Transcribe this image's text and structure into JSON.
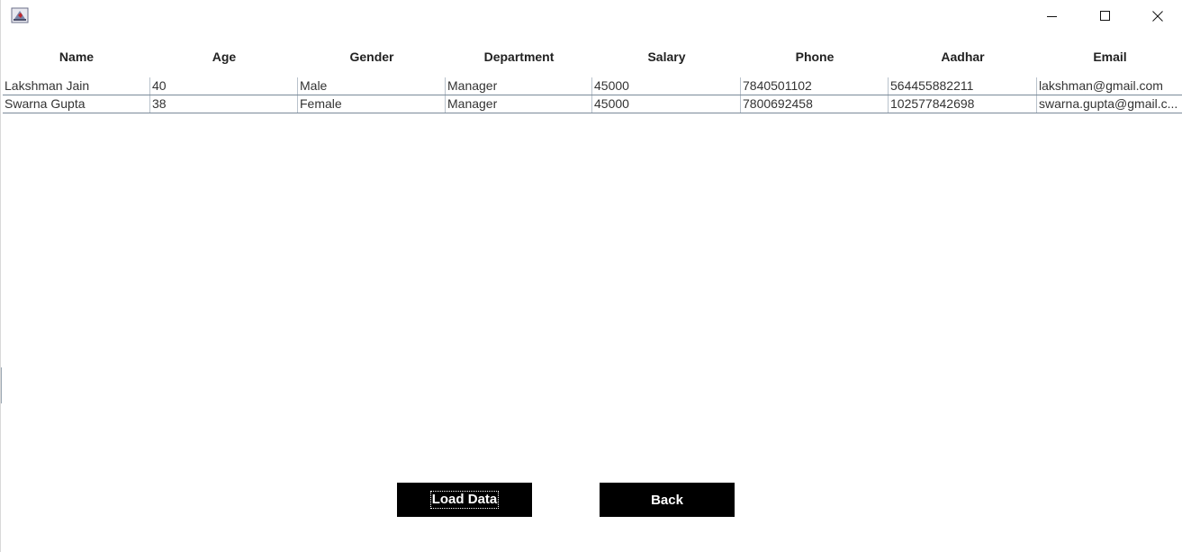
{
  "window": {
    "icon": "java-app-icon",
    "controls": {
      "minimize": "minimize-icon",
      "maximize": "maximize-icon",
      "close": "close-icon"
    }
  },
  "table": {
    "columns": [
      "Name",
      "Age",
      "Gender",
      "Department",
      "Salary",
      "Phone",
      "Aadhar",
      "Email"
    ],
    "rows": [
      [
        "Lakshman Jain",
        "40",
        "Male",
        "Manager",
        "45000",
        "7840501102",
        "564455882211",
        "lakshman@gmail.com"
      ],
      [
        "Swarna Gupta",
        "38",
        "Female",
        "Manager",
        "45000",
        "7800692458",
        "102577842698",
        "swarna.gupta@gmail.c..."
      ]
    ]
  },
  "buttons": {
    "load_data": "Load Data",
    "back": "Back"
  },
  "colors": {
    "button_bg": "#000000",
    "button_text": "#ffffff",
    "row_border": "#7a8a99"
  }
}
